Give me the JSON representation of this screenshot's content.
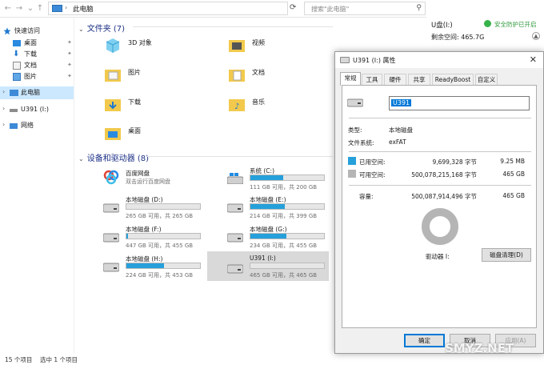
{
  "address": {
    "path": "此电脑",
    "search_placeholder": "搜索\"此电脑\""
  },
  "sidebar": {
    "quick_access": "快速访问",
    "items": [
      "桌面",
      "下载",
      "文档",
      "图片"
    ],
    "this_pc": "此电脑",
    "drive": "U391 (I:)",
    "network": "网络"
  },
  "folders": {
    "header": "文件夹 (7)",
    "items": [
      "3D 对象",
      "视频",
      "图片",
      "文档",
      "下载",
      "音乐",
      "桌面"
    ]
  },
  "drives": {
    "header": "设备和驱动器 (8)",
    "baidu": {
      "name": "百度网盘",
      "sub": "双击运行百度网盘"
    },
    "items": [
      {
        "name": "系统 (C:)",
        "space": "111 GB 可用，共 200 GB",
        "used": 0.445
      },
      {
        "name": "本地磁盘 (D:)",
        "space": "265 GB 可用，共 265 GB",
        "used": 0.0
      },
      {
        "name": "本地磁盘 (E:)",
        "space": "214 GB 可用，共 399 GB",
        "used": 0.464
      },
      {
        "name": "本地磁盘 (F:)",
        "space": "447 GB 可用，共 455 GB",
        "used": 0.018
      },
      {
        "name": "本地磁盘 (G:)",
        "space": "234 GB 可用，共 455 GB",
        "used": 0.486
      },
      {
        "name": "本地磁盘 (H:)",
        "space": "224 GB 可用，共 453 GB",
        "used": 0.506
      },
      {
        "name": "U391 (I:)",
        "space": "465 GB 可用，共 465 GB",
        "used": 0.0
      }
    ]
  },
  "rpane": {
    "title": "U盘(I:)",
    "badge": "安全防护已开启",
    "free": "剩余空间: 465.7G"
  },
  "status": {
    "count": "15 个项目",
    "selected": "选中 1 个项目"
  },
  "dialog": {
    "title": "U391 (I:) 属性",
    "tabs": [
      "常规",
      "工具",
      "硬件",
      "共享",
      "ReadyBoost",
      "自定义"
    ],
    "name_value": "U391",
    "type_label": "类型:",
    "type_value": "本地磁盘",
    "fs_label": "文件系统:",
    "fs_value": "exFAT",
    "used_label": "已用空间:",
    "used_bytes": "9,699,328 字节",
    "used_h": "9.25 MB",
    "free_label": "可用空间:",
    "free_bytes": "500,078,215,168 字节",
    "free_h": "465 GB",
    "cap_label": "容量:",
    "cap_bytes": "500,087,914,496 字节",
    "cap_h": "465 GB",
    "drive_label": "驱动器 I:",
    "cleanup": "磁盘清理(D)",
    "ok": "确定",
    "cancel": "取消",
    "apply": "应用(A)",
    "used_color": "#26a0da",
    "free_color": "#b5b5b5"
  },
  "watermark": "SMYZ.NET"
}
